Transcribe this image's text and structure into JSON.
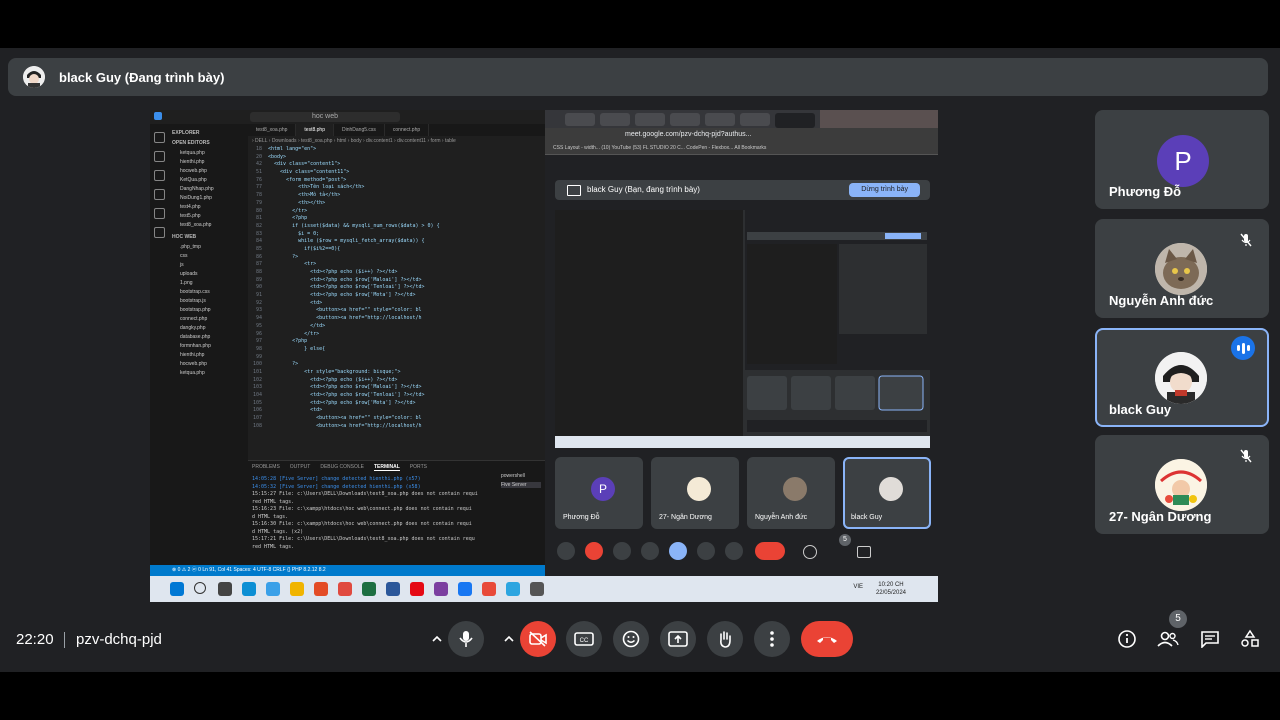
{
  "presenter": {
    "title": "black Guy (Đang trình bày)"
  },
  "shared_screen": {
    "vscode": {
      "search": "hoc web",
      "explorer_header": "EXPLORER",
      "open_editors": "OPEN EDITORS",
      "open_files": [
        "ketqua.php",
        "hienthi.php",
        "hocweb.php",
        "KetQua.php",
        "DangNhap.php",
        "NoiDung1.php",
        "test4.php",
        "test5.php",
        "test8_xoa.php"
      ],
      "folder": "HOC WEB",
      "folder_files": [
        ".php_tmp",
        "css",
        "js",
        "uploads",
        "1.png",
        "bootstrap.css",
        "bootstrap.js",
        "bootstrap.php",
        "connect.php",
        "dangky.php",
        "database.php",
        "formnhan.php",
        "hienthi.php",
        "hocweb.php",
        "ketqua.php"
      ],
      "tabs": [
        "test8_xoa.php",
        "test8.php",
        "DinhDang5.css",
        "connect.php"
      ],
      "code": [
        {
          "n": "18",
          "t": "<html lang=\"en\">"
        },
        {
          "n": "20",
          "t": "<body>"
        },
        {
          "n": "42",
          "t": "  <div class=\"content1\">"
        },
        {
          "n": "51",
          "t": "    <div class=\"content11\">"
        },
        {
          "n": "76",
          "t": "      <form method=\"post\">"
        },
        {
          "n": "77",
          "t": "          <th>Tên loại sách</th>"
        },
        {
          "n": "78",
          "t": "          <th>Mô tả</th>"
        },
        {
          "n": "79",
          "t": "          <th></th>"
        },
        {
          "n": "80",
          "t": "        </tr>"
        },
        {
          "n": "81",
          "t": "        <?php"
        },
        {
          "n": "82",
          "t": "        if (isset($data) && mysqli_num_rows($data) > 0) {"
        },
        {
          "n": "83",
          "t": "          $i = 0;"
        },
        {
          "n": "84",
          "t": "          while ($row = mysqli_fetch_array($data)) {"
        },
        {
          "n": "85",
          "t": "            if($i%2==0){"
        },
        {
          "n": "86",
          "t": "        ?>"
        },
        {
          "n": "87",
          "t": "            <tr>"
        },
        {
          "n": "88",
          "t": "              <td><?php echo ($i++) ?></td>"
        },
        {
          "n": "89",
          "t": "              <td><?php echo $row['Maloai'] ?></td>"
        },
        {
          "n": "90",
          "t": "              <td><?php echo $row['Tenloai'] ?></td>"
        },
        {
          "n": "91",
          "t": "              <td><?php echo $row['Mota'] ?></td>"
        },
        {
          "n": "92",
          "t": "              <td>"
        },
        {
          "n": "93",
          "t": "                <button><a href=\"\" style=\"color: bl"
        },
        {
          "n": "94",
          "t": "                <button><a href=\"http://localhost/h"
        },
        {
          "n": "95",
          "t": "              </td>"
        },
        {
          "n": "96",
          "t": "            </tr>"
        },
        {
          "n": "97",
          "t": "        <?php"
        },
        {
          "n": "98",
          "t": "            } else{"
        },
        {
          "n": "99",
          "t": ""
        },
        {
          "n": "100",
          "t": "        ?>"
        },
        {
          "n": "101",
          "t": "            <tr style=\"background: bisque;\">"
        },
        {
          "n": "102",
          "t": "              <td><?php echo ($i++) ?></td>"
        },
        {
          "n": "103",
          "t": "              <td><?php echo $row['Maloai'] ?></td>"
        },
        {
          "n": "104",
          "t": "              <td><?php echo $row['Tenloai'] ?></td>"
        },
        {
          "n": "105",
          "t": "              <td><?php echo $row['Mota'] ?></td>"
        },
        {
          "n": "106",
          "t": "              <td>"
        },
        {
          "n": "107",
          "t": "                <button><a href=\"\" style=\"color: bl"
        },
        {
          "n": "108",
          "t": "                <button><a href=\"http://localhost/h"
        }
      ],
      "terminal_tabs": [
        "PROBLEMS",
        "OUTPUT",
        "DEBUG CONSOLE",
        "TERMINAL",
        "PORTS"
      ],
      "terminal_lines": [
        "14:05:28 [Five Server] change detected hienthi.php (x57)",
        "14:05:32 [Five Server] change detected hienthi.php (x58)",
        "15:15:27 File: c:\\Users\\DELL\\Downloads\\test8_xoa.php does not contain requi",
        "red HTML tags.",
        "15:16:23 File: c:\\xampp\\htdocs\\hoc web\\connect.php does not contain requi",
        "d HTML tags.",
        "15:16:30 File: c:\\xampp\\htdocs\\hoc web\\connect.php does not contain requi",
        "d HTML tags. (x2)",
        "15:17:21 File: c:\\Users\\DELL\\Downloads\\test8_xoa.php does not contain requ",
        "red HTML tags."
      ],
      "terminal_panels": [
        "powershell",
        "Five Server"
      ],
      "status": "⊗ 0 ⚠ 2   ⓦ 0          Ln 91, Col 41  Spaces: 4  UTF-8  CRLF  {} PHP  8.2.12  8.2"
    },
    "chrome": {
      "url": "meet.google.com/pzv-dchq-pjd?authus...",
      "bookmarks": "CSS Layout - width...   (10) YouTube   (53) FL STUDIO 20 C...   CodePen - Flexbox...      All Bookmarks",
      "inner_title": "black Guy (Bạn, đang trình bày)",
      "stop_button": "Dừng trình bày",
      "inner_tiles": [
        "Phương Đỗ",
        "27- Ngân Dương",
        "Nguyễn Anh đức",
        "black Guy"
      ],
      "inner_tile_letter": "P",
      "badge": "5"
    },
    "taskbar": {
      "time": "10:20 CH",
      "date": "22/05/2024",
      "lang": "VIE"
    }
  },
  "participants": [
    {
      "name": "Phương Đỗ",
      "letter": "P",
      "avatar_color": "#5b3fb8"
    },
    {
      "name": "Nguyễn Anh đức",
      "muted": true
    },
    {
      "name": "black Guy",
      "speaking": true
    },
    {
      "name": "27- Ngân Dương",
      "muted": true
    }
  ],
  "bottom": {
    "time": "22:20",
    "meeting_code": "pzv-dchq-pjd",
    "people_count": "5"
  },
  "colors": {
    "background": "#202124",
    "tile": "#3c4043",
    "accent": "#8ab4f8",
    "hangup": "#ea4335"
  }
}
